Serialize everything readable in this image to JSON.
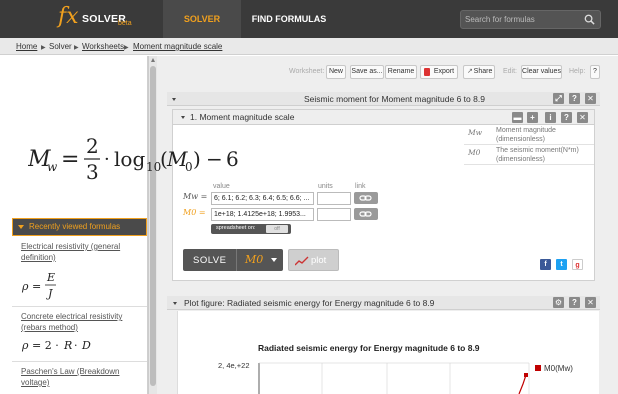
{
  "brand": {
    "fx": "fx",
    "name": "SOLVER",
    "tag": "beta",
    "accent": "#f0a01e"
  },
  "nav": {
    "solver": "SOLVER",
    "find": "FIND FORMULAS"
  },
  "search": {
    "placeholder": "Search for formulas",
    "icon": "magnifier-icon"
  },
  "breadcrumb": [
    "Home",
    "Solver",
    "Worksheets",
    "Moment magnitude scale"
  ],
  "toolbar": {
    "worksheet_label": "Worksheet:",
    "new": "New",
    "save_as": "Save as...",
    "rename": "Rename",
    "export": "Export",
    "share": "Share",
    "edit_label": "Edit:",
    "clear": "Clear values",
    "help_label": "Help:",
    "help": "?"
  },
  "worksheet": {
    "title": "Seismic moment for Moment magnitude 6 to 8.9"
  },
  "formula_panel": {
    "title": "1. Moment magnitude scale",
    "variables": [
      {
        "symbol": "Mw",
        "desc": "Moment magnitude (dimensionless)"
      },
      {
        "symbol": "M0",
        "desc": "The seismic moment(N*m) (dimensionless)"
      }
    ],
    "col_value": "value",
    "col_units": "units",
    "col_link": "link",
    "rows": [
      {
        "label": "Mw =",
        "value": "6; 6.1; 6.2; 6.3; 6.4; 6.5; 6.6; ..."
      },
      {
        "label": "M0 =",
        "value": "1e+18; 1.4125e+18; 1.9953..."
      }
    ],
    "spreadsheet": "spreadsheet on:",
    "spreadsheet_off": "off",
    "solve": "SOLVE",
    "solve_for": "M0",
    "plot": "plot"
  },
  "recent": {
    "header": "Recently viewed formulas",
    "items": [
      {
        "title": "Electrical resistivity (general definition)",
        "formula": "ρ = E / J"
      },
      {
        "title": "Concrete electrical resistivity (rebars method)",
        "formula": "ρ = 2 · R · D"
      },
      {
        "title": "Paschen's Law (Breakdown voltage)"
      }
    ]
  },
  "plot_panel": {
    "title": "Plot figure: Radiated seismic energy for Energy magnitude 6 to 8.9",
    "chart_title": "Radiated seismic energy for Energy magnitude 6 to 8.9",
    "y_tick": "2, 4e,+22",
    "legend": "M0(Mw)",
    "legend_color": "#c00000"
  }
}
